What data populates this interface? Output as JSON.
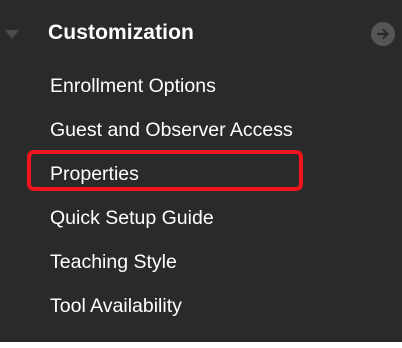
{
  "section": {
    "title": "Customization",
    "caret_icon": "caret-down-icon",
    "go_icon": "arrow-right-circle-icon"
  },
  "menu": {
    "items": [
      {
        "label": "Enrollment Options"
      },
      {
        "label": "Guest and Observer Access"
      },
      {
        "label": "Properties"
      },
      {
        "label": "Quick Setup Guide"
      },
      {
        "label": "Teaching Style"
      },
      {
        "label": "Tool Availability"
      }
    ]
  },
  "colors": {
    "panel_background": "#2a2a2a",
    "text": "#ffffff",
    "highlight_annotation": "#f0141e"
  }
}
